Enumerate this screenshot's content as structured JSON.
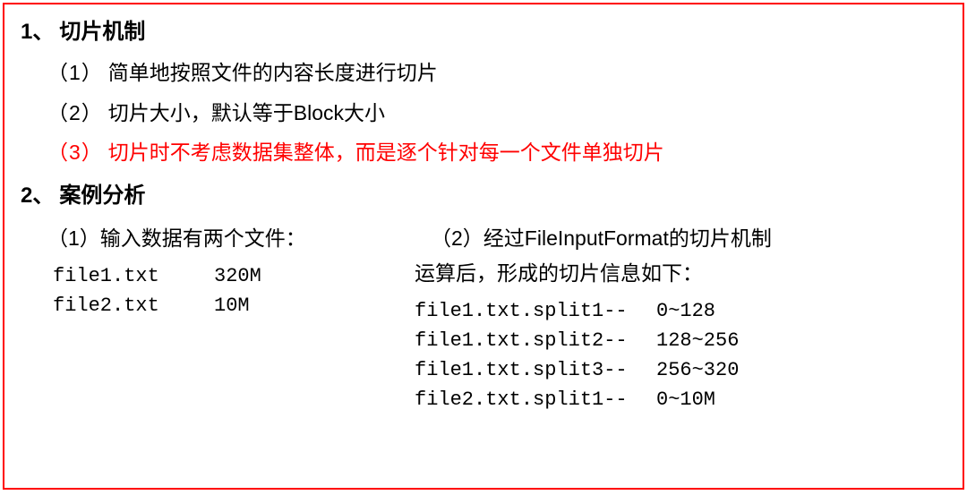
{
  "border_color": "#ff0000",
  "section1": {
    "num": "1、",
    "title": "切片机制",
    "points": [
      {
        "num": "（1）",
        "text": "简单地按照文件的内容长度进行切片",
        "red": false
      },
      {
        "num": "（2）",
        "text": "切片大小，默认等于Block大小",
        "red": false
      },
      {
        "num": "（3）",
        "text": "切片时不考虑数据集整体，而是逐个针对每一个文件单独切片",
        "red": true
      }
    ]
  },
  "section2": {
    "num": "2、",
    "title": "案例分析",
    "left": {
      "label_num": "（1）",
      "label_text": "输入数据有两个文件：",
      "files": [
        {
          "name": "file1.txt",
          "size": "320M"
        },
        {
          "name": "file2.txt",
          "size": "10M"
        }
      ]
    },
    "right": {
      "label_num": "（2）",
      "label_line1": "经过FileInputFormat的切片机制",
      "label_line2": "运算后，形成的切片信息如下：",
      "splits": [
        {
          "name": "file1.txt.split1--",
          "range": "0~128"
        },
        {
          "name": "file1.txt.split2--",
          "range": "128~256"
        },
        {
          "name": "file1.txt.split3--",
          "range": "256~320"
        },
        {
          "name": "file2.txt.split1--",
          "range": "0~10M"
        }
      ]
    }
  }
}
